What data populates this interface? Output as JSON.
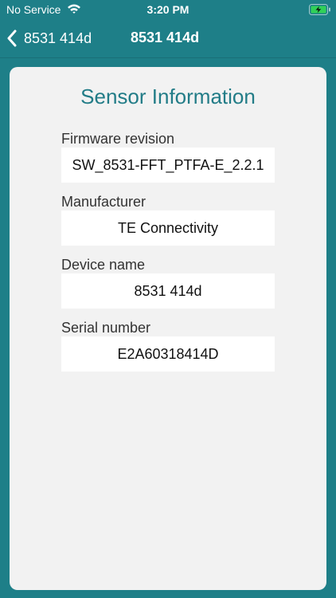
{
  "status_bar": {
    "carrier": "No Service",
    "time": "3:20 PM",
    "wifi_icon": "wifi-icon",
    "battery_icon": "battery-charging-icon",
    "battery_color": "#30d158"
  },
  "nav": {
    "back_label": "8531 414d",
    "back_icon": "chevron-left-icon",
    "title": "8531 414d"
  },
  "colors": {
    "background": "#1e7f88",
    "card": "#f2f2f2",
    "title": "#227c87"
  },
  "sensor_info": {
    "title": "Sensor Information",
    "fields": [
      {
        "label": "Firmware revision",
        "value": "SW_8531-FFT_PTFA-E_2.2.1"
      },
      {
        "label": "Manufacturer",
        "value": "TE Connectivity"
      },
      {
        "label": "Device name",
        "value": "8531 414d"
      },
      {
        "label": "Serial number",
        "value": "E2A60318414D"
      }
    ]
  }
}
